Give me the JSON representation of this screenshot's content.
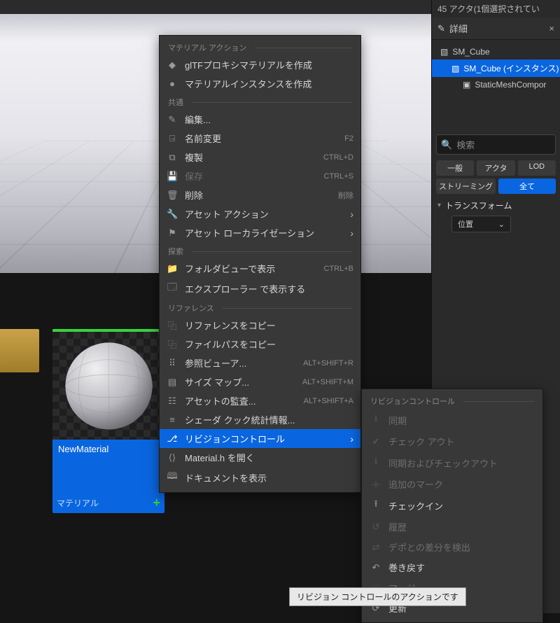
{
  "details": {
    "status": "45 アクタ(1個選択されてい",
    "tab_title": "詳細",
    "tree": {
      "root": "SM_Cube",
      "instance": "SM_Cube (インスタンス)",
      "component": "StaticMeshCompor"
    },
    "search_placeholder": "検索",
    "chips_row1": {
      "general": "一般",
      "actor": "アクタ",
      "lod": "LOD"
    },
    "chips_row2": {
      "streaming": "ストリーミング",
      "all": "全て"
    },
    "section_transform": "トランスフォーム",
    "transform_location": "位置"
  },
  "asset": {
    "name": "NewMaterial",
    "type": "マテリアル"
  },
  "menu": {
    "sections": {
      "material_actions": "マテリアル アクション",
      "common": "共通",
      "explore": "探索",
      "reference": "リファレンス"
    },
    "items": {
      "gltf": "glTFプロキシマテリアルを作成",
      "mat_inst": "マテリアルインスタンスを作成",
      "edit": "編集...",
      "rename": "名前変更",
      "duplicate": "複製",
      "save": "保存",
      "delete": "削除",
      "asset_actions": "アセット アクション",
      "asset_local": "アセット ローカライゼーション",
      "folder_view": "フォルダビューで表示",
      "explorer": "エクスプローラー で表示する",
      "copy_ref": "リファレンスをコピー",
      "copy_path": "ファイルパスをコピー",
      "ref_viewer": "参照ビューア...",
      "size_map": "サイズ マップ...",
      "audit": "アセットの監査...",
      "shader_cook": "シェーダ クック統計情報...",
      "revision": "リビジョンコントロール",
      "open_h": "Material.h を開く",
      "show_doc": "ドキュメントを表示"
    },
    "shortcuts": {
      "rename": "F2",
      "duplicate": "CTRL+D",
      "save": "CTRL+S",
      "delete": "削除",
      "folder_view": "CTRL+B",
      "ref_viewer": "ALT+SHIFT+R",
      "size_map": "ALT+SHIFT+M",
      "audit": "ALT+SHIFT+A"
    }
  },
  "submenu": {
    "title": "リビジョンコントロール",
    "items": {
      "sync": "同期",
      "checkout": "チェック アウト",
      "sync_checkout": "同期およびチェックアウト",
      "mark_add": "追加のマーク",
      "checkin": "チェックイン",
      "history": "履歴",
      "diff_depot": "デポとの差分を検出",
      "revert": "巻き戻す",
      "merge": "マージ",
      "refresh": "更新"
    }
  },
  "tooltip": "リビジョン コントロールのアクションです"
}
